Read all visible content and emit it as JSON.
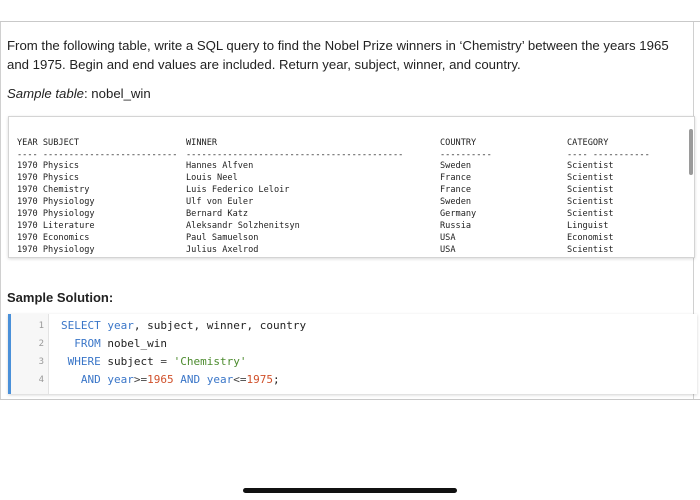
{
  "problem": {
    "text": "From the following table, write a SQL query to find the Nobel Prize winners in ‘Chemistry’ between the years 1965 and 1975. Begin and end values are included. Return year, subject, winner, and country."
  },
  "sample_table": {
    "label_prefix": "Sample table",
    "name": ": nobel_win"
  },
  "table": {
    "headers": [
      "YEAR SUBJECT",
      "WINNER",
      "COUNTRY",
      "CATEGORY"
    ],
    "separators": [
      "---- --------------------------",
      "------------------------------------------",
      "----------",
      "---- -----------"
    ],
    "rows": [
      [
        "1970 Physics",
        "Hannes Alfven",
        "Sweden",
        "Scientist"
      ],
      [
        "1970 Physics",
        "Louis Neel",
        "France",
        "Scientist"
      ],
      [
        "1970 Chemistry",
        "Luis Federico Leloir",
        "France",
        "Scientist"
      ],
      [
        "1970 Physiology",
        "Ulf von Euler",
        "Sweden",
        "Scientist"
      ],
      [
        "1970 Physiology",
        "Bernard Katz",
        "Germany",
        "Scientist"
      ],
      [
        "1970 Literature",
        "Aleksandr Solzhenitsyn",
        "Russia",
        "Linguist"
      ],
      [
        "1970 Economics",
        "Paul Samuelson",
        "USA",
        "Economist"
      ],
      [
        "1970 Physiology",
        "Julius Axelrod",
        "USA",
        "Scientist"
      ]
    ]
  },
  "solution": {
    "heading": "Sample Solution:",
    "line_numbers": [
      "1",
      "2",
      "3",
      "4"
    ],
    "lines": [
      [
        {
          "t": "SELECT",
          "c": "kw"
        },
        {
          "t": " ",
          "c": ""
        },
        {
          "t": "year",
          "c": "kw"
        },
        {
          "t": ", subject, winner, country",
          "c": ""
        }
      ],
      [
        {
          "t": "  ",
          "c": ""
        },
        {
          "t": "FROM",
          "c": "kw"
        },
        {
          "t": " nobel_win",
          "c": ""
        }
      ],
      [
        {
          "t": " ",
          "c": ""
        },
        {
          "t": "WHERE",
          "c": "kw"
        },
        {
          "t": " subject ",
          "c": ""
        },
        {
          "t": "=",
          "c": "op"
        },
        {
          "t": " ",
          "c": ""
        },
        {
          "t": "'Chemistry'",
          "c": "str"
        }
      ],
      [
        {
          "t": "   ",
          "c": ""
        },
        {
          "t": "AND",
          "c": "kw"
        },
        {
          "t": " ",
          "c": ""
        },
        {
          "t": "year",
          "c": "kw"
        },
        {
          "t": ">=",
          "c": "op"
        },
        {
          "t": "1965",
          "c": "num"
        },
        {
          "t": " ",
          "c": ""
        },
        {
          "t": "AND",
          "c": "kw"
        },
        {
          "t": " ",
          "c": ""
        },
        {
          "t": "year",
          "c": "kw"
        },
        {
          "t": "<=",
          "c": "op"
        },
        {
          "t": "1975",
          "c": "num"
        },
        {
          "t": ";",
          "c": ""
        }
      ]
    ]
  },
  "colors": {
    "keyword": "#3a76c8",
    "string": "#4b8a2d",
    "number": "#d0502a",
    "code_accent": "#4a90d9"
  }
}
